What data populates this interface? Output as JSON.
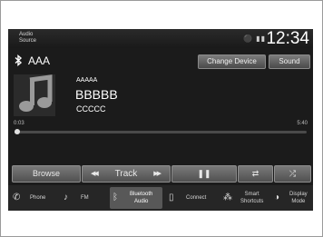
{
  "status": {
    "source_label": "Audio\nSource",
    "clock": "12:34"
  },
  "header": {
    "device_name": "AAA",
    "change_device_label": "Change Device",
    "sound_label": "Sound"
  },
  "track": {
    "artist": "AAAAA",
    "title": "BBBBB",
    "album": "CCCCC",
    "elapsed": "0:03",
    "total": "5:40",
    "progress": 0.01
  },
  "controls": {
    "browse_label": "Browse",
    "track_label": "Track",
    "pause_symbol": "❚❚",
    "repeat_symbol": "⇄",
    "shuffle_symbol": "⤮"
  },
  "bottom_bar": {
    "phone_label": "Phone",
    "fm_label": "FM",
    "bt_audio_label": "Bluetooth\nAudio",
    "connect_label": "Connect",
    "smart_shortcuts_label": "Smart\nShortcuts",
    "display_mode_label": "Display\nMode"
  },
  "colors": {
    "screen_bg": "#1b1b1b",
    "button_top": "#7a7a7a",
    "active_tab": "#585858"
  }
}
